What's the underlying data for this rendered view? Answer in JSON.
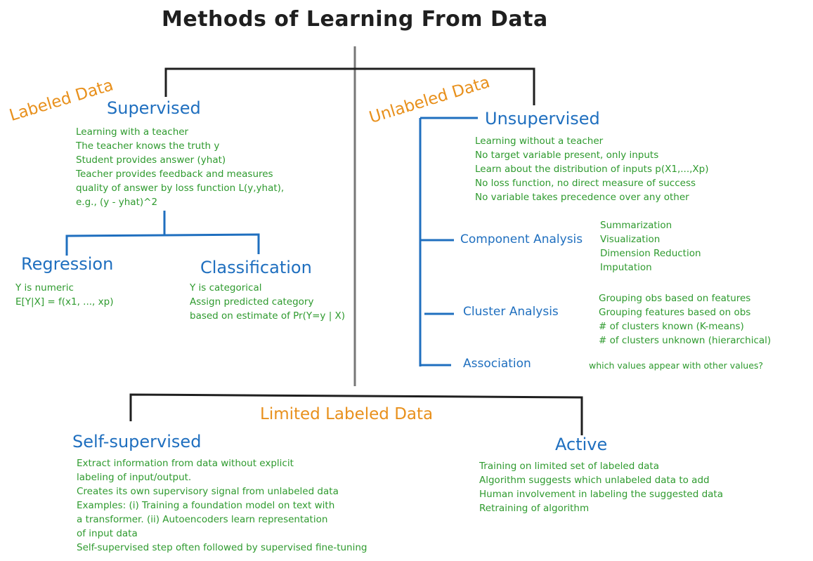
{
  "title": "Methods of Learning From Data",
  "labeled_data": "Labeled Data",
  "unlabeled_data": "Unlabeled Data",
  "limited_labeled_data": "Limited Labeled Data",
  "supervised": {
    "heading": "Supervised",
    "lines": [
      "Learning with a teacher",
      "The teacher knows the truth y",
      "Student provides answer (yhat)",
      "Teacher provides feedback and measures",
      "quality of answer by loss function L(y,yhat),",
      "e.g., (y - yhat)^2"
    ]
  },
  "regression": {
    "heading": "Regression",
    "lines": [
      "Y is numeric",
      "E[Y|X] = f(x1, ..., xp)"
    ]
  },
  "classification": {
    "heading": "Classification",
    "lines": [
      "Y is categorical",
      "Assign predicted category",
      "based on estimate of Pr(Y=y | X)"
    ]
  },
  "unsupervised": {
    "heading": "Unsupervised",
    "lines": [
      "Learning without a teacher",
      "No target variable present, only inputs",
      "Learn about the distribution of inputs p(X1,...,Xp)",
      "No loss function, no direct measure of success",
      "No variable takes precedence over any other"
    ]
  },
  "component_analysis": {
    "heading": "Component Analysis",
    "lines": [
      "Summarization",
      "Visualization",
      "Dimension Reduction",
      "Imputation"
    ]
  },
  "cluster_analysis": {
    "heading": "Cluster Analysis",
    "lines": [
      "Grouping obs based on features",
      "Grouping features based on obs",
      "# of clusters known (K-means)",
      "# of clusters unknown (hierarchical)"
    ]
  },
  "association": {
    "heading": "Association",
    "lines": [
      "which values appear with other values?"
    ]
  },
  "self_supervised": {
    "heading": "Self-supervised",
    "lines": [
      "Extract information from data without explicit",
      "labeling of input/output.",
      "Creates its own supervisory signal from unlabeled data",
      "Examples:  (i) Training a foundation model on text with",
      "a transformer. (ii) Autoencoders learn representation",
      "of input data",
      "Self-supervised step often followed by supervised fine-tuning"
    ]
  },
  "active": {
    "heading": "Active",
    "lines": [
      "Training on limited set of labeled data",
      "Algorithm suggests which unlabeled data to add",
      "Human involvement in labeling the suggested data",
      "Retraining of algorithm"
    ]
  },
  "colors": {
    "line_black": "#1f1f1f",
    "line_gray": "#777777",
    "line_blue": "#1f6fbf",
    "heading_blue": "#1f6fbf",
    "body_green": "#2e9a2e",
    "label_orange": "#e8901c"
  }
}
